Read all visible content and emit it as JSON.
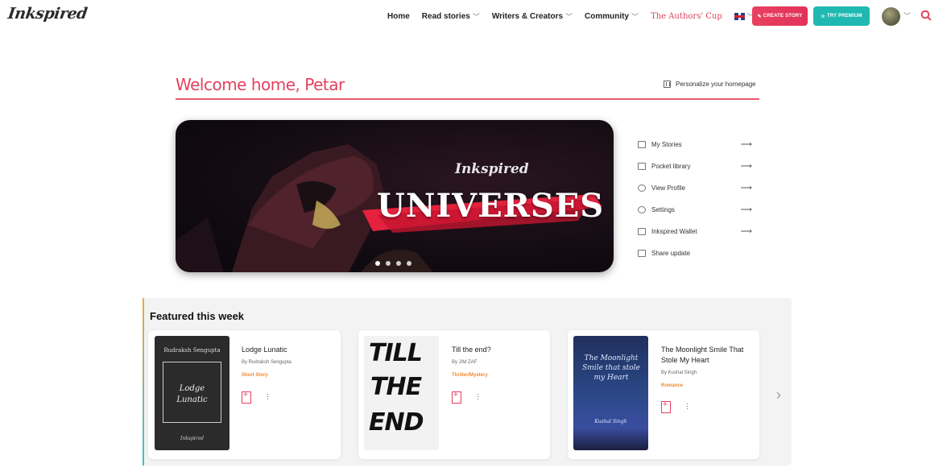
{
  "header": {
    "logo": "Inkspired",
    "nav": {
      "home": "Home",
      "read_stories": "Read stories",
      "writers": "Writers & Creators",
      "community": "Community",
      "authors_cup": "The Authors' Cup",
      "notification_count": "0"
    },
    "create_story": "CREATE STORY",
    "try_premium": "TRY PREMIUM"
  },
  "welcome": {
    "title": "Welcome home, Petar",
    "personalize": "Personalize your homepage"
  },
  "banner": {
    "brand": "Inkspired",
    "title": "UNIVERSES",
    "slide_count": 4,
    "active_slide": 1
  },
  "sidemenu": {
    "items": [
      {
        "label": "My Stories"
      },
      {
        "label": "Pocket library"
      },
      {
        "label": "View Profile"
      },
      {
        "label": "Settings"
      },
      {
        "label": "Inkspired Wallet"
      },
      {
        "label": "Share update"
      }
    ]
  },
  "featured": {
    "title": "Featured this week",
    "cards": [
      {
        "title": "Lodge Lunatic",
        "author": "By Rudraksh Sengupta",
        "genre": "Short Story",
        "cover_author": "Rudraksh Sengupta",
        "cover_title_1": "Lodge",
        "cover_title_2": "Lunatic",
        "cover_brand": "Inkspired"
      },
      {
        "title": "Till the end?",
        "author": "By JIM ZAF",
        "genre": "Thriller/Mystery",
        "cover_title_1": "TILL",
        "cover_title_2": "THE",
        "cover_title_3": "END"
      },
      {
        "title": "The Moonlight Smile That Stole My Heart",
        "author": "By Kushal Singh",
        "genre": "Romance",
        "cover_title": "The Moonlight Smile that stole my Heart",
        "cover_author": "Kushal Singh"
      }
    ]
  },
  "colors": {
    "accent": "#e5405e",
    "teal": "#1fb9b1",
    "genre": "#f08a2c"
  }
}
